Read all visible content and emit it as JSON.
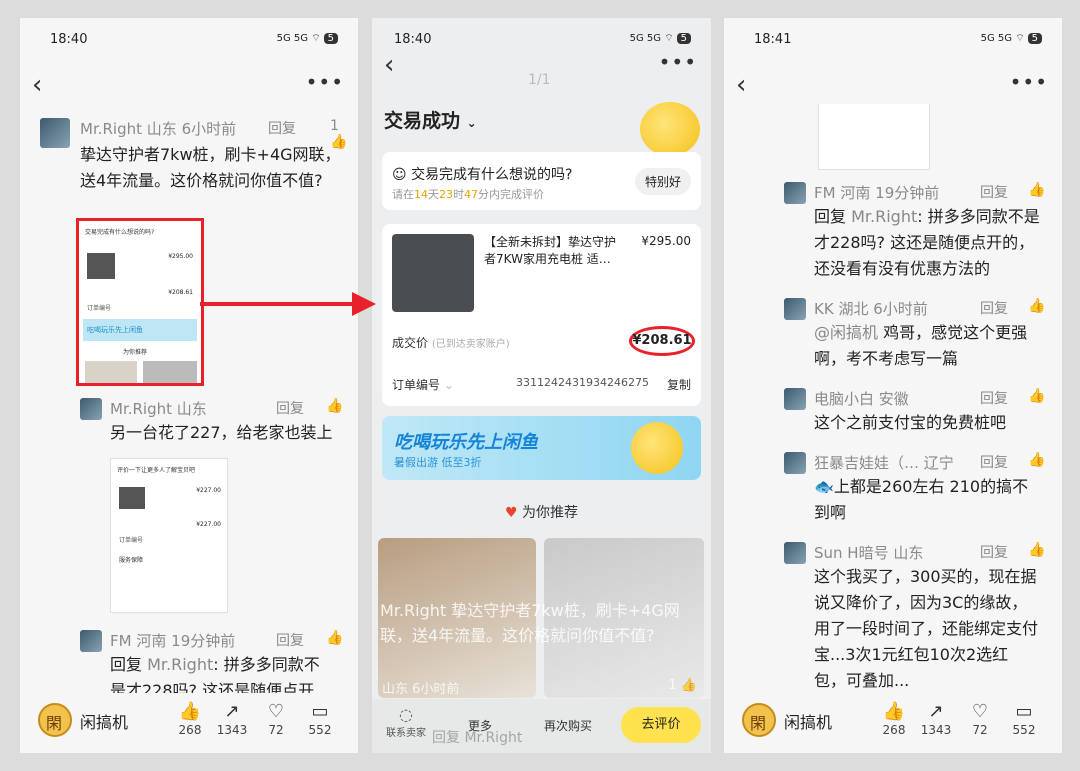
{
  "left": {
    "status": {
      "time": "18:40",
      "right": "5G 5G ⌔",
      "battery": "5"
    },
    "comment1": {
      "author": "Mr.Right",
      "location": "山东",
      "time": "6小时前",
      "reply": "回复",
      "likes": "1",
      "text": "挚达守护者7kw桩，刷卡+4G网联，送4年流量。这价格就问你值不值?"
    },
    "comment2": {
      "author": "Mr.Right",
      "location": "山东",
      "reply": "回复",
      "text": "另一台花了227，给老家也装上"
    },
    "comment3": {
      "author": "FM",
      "location": "河南",
      "time": "19分钟前",
      "reply": "回复",
      "text_prefix": "回复 ",
      "mention": "Mr.Right",
      "text": ": 拼多多同款不是才228吗? 这还是随便点开"
    },
    "thumb1": {
      "title": "交易完成有什么想说的吗?",
      "price1": "¥295.00",
      "price2": "¥208.61",
      "order": "订单编号",
      "banner": "吃喝玩乐先上闲鱼",
      "rec": "为你推荐"
    },
    "thumb2": {
      "title": "评价一下让更多人了解宝贝吧",
      "price1": "¥227.00",
      "price2": "¥227.00",
      "order": "订单编号",
      "section": "服务保障"
    }
  },
  "middle": {
    "status": {
      "time": "18:40",
      "right": "5G 5G ⌔",
      "battery": "5"
    },
    "page_indicator": "1/1",
    "header": "交易成功",
    "feedback": {
      "title": "交易完成有什么想说的吗?",
      "sub_prefix": "请在",
      "days": "14",
      "d": "天",
      "hours": "23",
      "h": "时",
      "minutes": "47",
      "m": "分内完成评价",
      "button": "特别好"
    },
    "product": {
      "title": "【全新未拆封】挚达守护者7KW家用充电桩 适…",
      "price": "¥295.00",
      "deal_label": "成交价",
      "deal_note": "(已到达卖家账户)",
      "deal_price": "¥208.61",
      "order_label": "订单编号",
      "order_no": "3311242431934246275",
      "copy": "复制"
    },
    "banner": {
      "title": "吃喝玩乐先上闲鱼",
      "sub": "暑假出游 低至3折"
    },
    "recommend": "为你推荐",
    "overlay": {
      "author": "Mr.Right",
      "text": "挚达守护者7kw桩，刷卡+4G网联，送4年流量。这价格就问你值不值?",
      "location": "山东",
      "time": "6小时前",
      "likes": "1"
    },
    "bottom": {
      "contact": "联系卖家",
      "more": "更多",
      "rebuy": "再次购买",
      "review": "去评价",
      "reply": "回复",
      "mention": "Mr.Right"
    }
  },
  "right": {
    "status": {
      "time": "18:41",
      "right": "5G 5G ⌔",
      "battery": "5"
    },
    "comments": [
      {
        "author": "FM",
        "location": "河南",
        "time": "19分钟前",
        "reply": "回复",
        "prefix": "回复 ",
        "mention": "Mr.Right",
        "text": ": 拼多多同款不是才228吗? 这还是随便点开的，还没看有没有优惠方法的"
      },
      {
        "author": "KK",
        "location": "湖北",
        "time": "6小时前",
        "reply": "回复",
        "prefix": "",
        "mention": "@闲搞机",
        "text": " 鸡哥，感觉这个更强啊，考不考虑写一篇"
      },
      {
        "author": "电脑小白",
        "location": "安徽",
        "time": "",
        "reply": "回复",
        "prefix": "",
        "mention": "",
        "text": "这个之前支付宝的免费桩吧"
      },
      {
        "author": "狂暴吉娃娃（…",
        "location": "辽宁",
        "time": "",
        "reply": "回复",
        "prefix": "",
        "mention": "",
        "text": "🐟上都是260左右 210的搞不到啊"
      },
      {
        "author": "Sun H暗号",
        "location": "山东",
        "time": "",
        "reply": "回复",
        "prefix": "",
        "mention": "",
        "text": "这个我买了，300买的，现在据说又降价了，因为3C的缘故，用了一段时间了，还能绑定支付宝...3次1元红包10次2选红包，可叠加..."
      }
    ]
  },
  "footer": {
    "brand": "闲搞机",
    "likes": "268",
    "shares": "1343",
    "favs": "72",
    "comments": "552"
  }
}
